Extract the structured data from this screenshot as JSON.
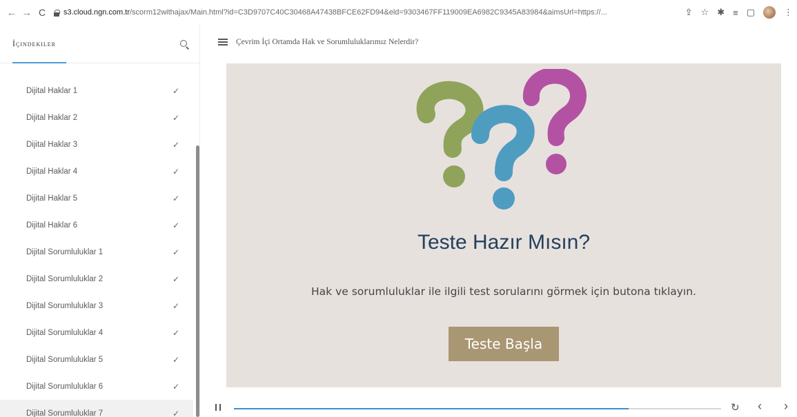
{
  "browser": {
    "back": "←",
    "forward": "→",
    "reload": "C",
    "url_host": "s3.cloud.ngn.com.tr",
    "url_rest": "/scorm12withajax/Main.html?id=C3D9707C40C30468A47438BFCE62FD94&eld=9303467FF119009EA6982C9345A83984&aimsUrl=https://..."
  },
  "sidebar": {
    "title": "İçindekiler",
    "items": [
      {
        "label": "Dijital Haklar 1"
      },
      {
        "label": "Dijital Haklar 2"
      },
      {
        "label": "Dijital Haklar 3"
      },
      {
        "label": "Dijital Haklar 4"
      },
      {
        "label": "Dijital Haklar 5"
      },
      {
        "label": "Dijital Haklar 6"
      },
      {
        "label": "Dijital Sorumluluklar 1"
      },
      {
        "label": "Dijital Sorumluluklar 2"
      },
      {
        "label": "Dijital Sorumluluklar 3"
      },
      {
        "label": "Dijital Sorumluluklar 4"
      },
      {
        "label": "Dijital Sorumluluklar 5"
      },
      {
        "label": "Dijital Sorumluluklar 6"
      },
      {
        "label": "Dijital Sorumluluklar 7"
      }
    ],
    "check_glyph": "✓"
  },
  "main": {
    "lesson_title": "Çevrim İçi Ortamda Hak ve Sorumluluklarımız Nelerdir?",
    "slide": {
      "heading": "Teste Hazır Mısın?",
      "text": "Hak ve sorumluluklar ile ilgili test sorularını görmek için butona tıklayın.",
      "button": "Teste Başla"
    },
    "player": {
      "progress": 0.81,
      "replay": "↻",
      "prev": "‹",
      "next": "›"
    }
  },
  "colors": {
    "accent": "#3b8fd0",
    "button": "#a99673",
    "slide_bg": "#e7e1de",
    "qmark_green": "#8fa45a",
    "qmark_blue": "#4f9cc1",
    "qmark_purple": "#b352a3"
  }
}
